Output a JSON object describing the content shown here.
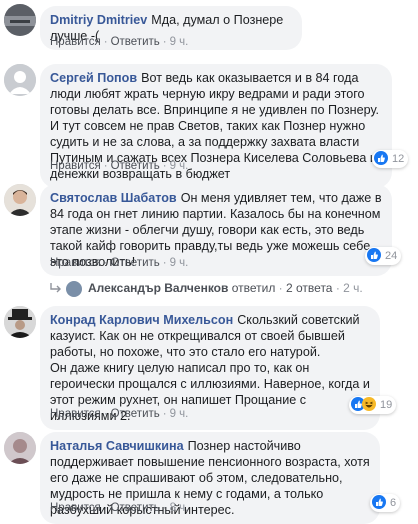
{
  "comments": [
    {
      "author": "Dmitriy Dmitriev",
      "text": "Мда, думал о Познере лучше -(",
      "like": "Нравится",
      "reply": "Ответить",
      "time": "9 ч."
    },
    {
      "author": "Сергей Попов",
      "text": "Вот ведь как оказывается и в 84 года люди любят жрать черную икру ведрами и ради этого готовы делать все. Впринципе я не удивлен по Познеру. И тут совсем не прав Светов, таких как Познер нужно судить и не за слова, а за поддержку захвата власти Путиным и сажать всех Познера Киселева Соловьева и денежки возвращать в бюджет",
      "like": "Нравится",
      "reply": "Ответить",
      "time": "9 ч.",
      "reactions": "12"
    },
    {
      "author": "Святослав Шабатов",
      "text": "Он меня удивляет тем, что даже в 84 года он гнет линию партии. Казалось бы на конечном этапе жизни - облегчи душу, говори как есть, это ведь такой кайф говорить правду,ты ведь уже можешь себе это позволить!",
      "like": "Нравится",
      "reply": "Ответить",
      "time": "9 ч.",
      "reactions": "24",
      "replies_summary": {
        "name": "Александър Валченков",
        "action": "ответил",
        "count": "2 ответа",
        "time": "2 ч."
      }
    },
    {
      "author": "Конрад Карлович Михельсон",
      "text": "Скользкий советский казуист. Как он не открещивался от своей бывшей работы, но похоже, что это стало его натурой.\nОн даже книгу целую написал про то, как он героически прощался с иллюзиями. Наверное, когда и этот режим рухнет, он напишет Прощание с иллюзиями 2.",
      "like": "Нравится",
      "reply": "Ответить",
      "time": "9 ч.",
      "reactions": "19"
    },
    {
      "author": "Наталья Савчишкина",
      "text": "Познер настойчиво поддерживает повышение пенсионного возраста, хотя его даже не спрашивают об этом, следовательно, мудрость не пришла к нему с годами, а только разбухший корыстный интерес.",
      "like": "Нравится",
      "reply": "Ответить",
      "time": "8 ч.",
      "reactions": "6"
    }
  ],
  "colors": {
    "author": "#385898",
    "bubble": "#f2f3f5",
    "like": "#1877f2",
    "haha": "#f7b928"
  },
  "icons": [
    "like-icon",
    "haha-icon",
    "reply-arrow-icon"
  ]
}
